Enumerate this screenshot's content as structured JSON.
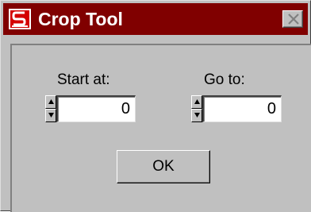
{
  "window": {
    "title": "Crop Tool",
    "app_icon": "app-logo-icon",
    "close_icon": "close-icon"
  },
  "fields": {
    "start": {
      "label": "Start at:",
      "value": "0"
    },
    "goto": {
      "label": "Go to:",
      "value": "0"
    }
  },
  "buttons": {
    "ok_label": "OK"
  },
  "colors": {
    "titlebar": "#800000",
    "face": "#c0c0c0",
    "field": "#ffffff"
  }
}
